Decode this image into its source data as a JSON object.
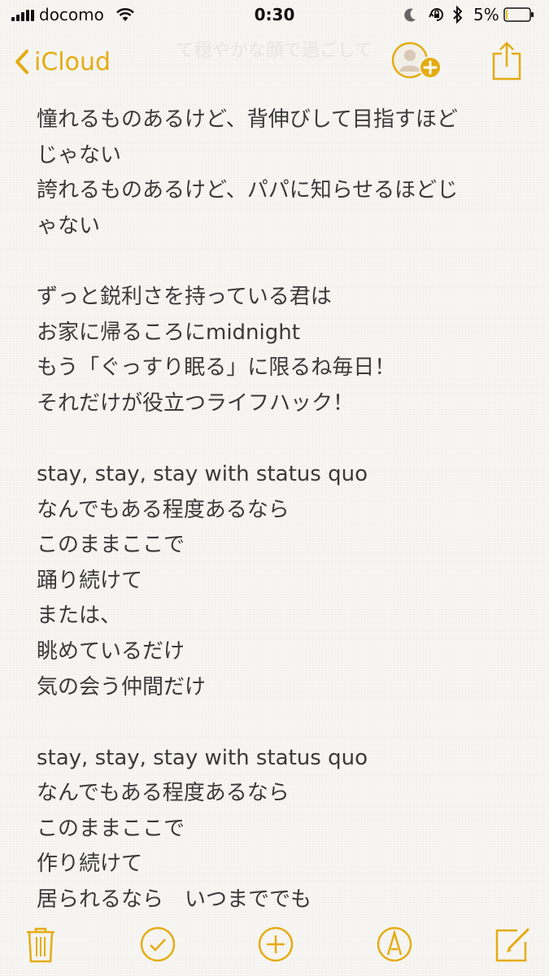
{
  "status_bar": {
    "carrier": "docomo",
    "time": "0:30",
    "battery_percent": "5%",
    "battery_level": 0.05
  },
  "nav": {
    "back_label": "iCloud",
    "faded_title": "て穏やかな顔で過ごして"
  },
  "note": {
    "lines": [
      "憧れるものあるけど、背伸びして目指すほど",
      "じゃない",
      "誇れるものあるけど、パパに知らせるほどじ",
      "ゃない",
      "",
      "ずっと鋭利さを持っている君は",
      "お家に帰るころにmidnight",
      "もう「ぐっすり眠る」に限るね毎日！",
      "それだけが役立つライフハック！",
      "",
      "stay, stay, stay with status quo",
      "なんでもある程度あるなら",
      "このままここで",
      "踊り続けて",
      "または、",
      "眺めているだけ",
      "気の会う仲間だけ",
      "",
      "stay, stay, stay with status quo",
      "なんでもある程度あるなら",
      "このままここで",
      "作り続けて",
      "居られるなら　いつまででも"
    ]
  },
  "toolbar": {
    "icons": [
      "trash-icon",
      "checklist-icon",
      "add-icon",
      "markup-icon",
      "compose-icon"
    ]
  },
  "colors": {
    "accent": "#e4ac13",
    "text": "#3a3a3a",
    "background": "#f7f6f3"
  }
}
